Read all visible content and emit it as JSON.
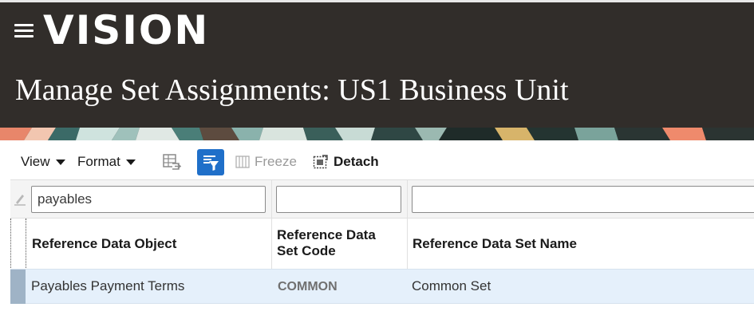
{
  "app": {
    "logo_text": "VISION"
  },
  "header": {
    "title": "Manage Set Assignments: US1 Business Unit",
    "background": "#312d2a"
  },
  "toolbar": {
    "view_label": "View",
    "format_label": "Format",
    "freeze_label": "Freeze",
    "detach_label": "Detach",
    "icons": [
      "export-icon",
      "query-by-example-icon",
      "freeze-icon",
      "detach-icon"
    ],
    "accent": "#1f6fc9"
  },
  "table": {
    "filters": {
      "col1_value": "payables",
      "col2_value": "",
      "col3_value": ""
    },
    "columns": [
      "Reference Data Object",
      "Reference Data Set Code",
      "Reference Data Set Name"
    ],
    "rows": [
      {
        "object": "Payables Payment Terms",
        "set_code": "COMMON",
        "set_name": "Common Set"
      }
    ],
    "selected_row_color": "#e5f0fb"
  }
}
